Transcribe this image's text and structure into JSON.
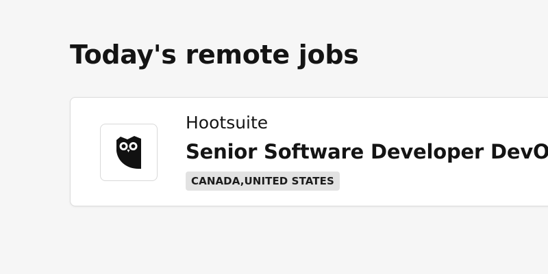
{
  "page": {
    "heading": "Today's remote jobs"
  },
  "jobs": [
    {
      "company": "Hootsuite",
      "title": "Senior Software Developer DevOps",
      "locations": "CANADA,UNITED STATES",
      "logo_icon": "hootsuite-owl-icon"
    }
  ],
  "colors": {
    "background": "#f6f6f6",
    "card": "#ffffff",
    "tag_background": "#e2e2e2",
    "text": "#141414"
  }
}
